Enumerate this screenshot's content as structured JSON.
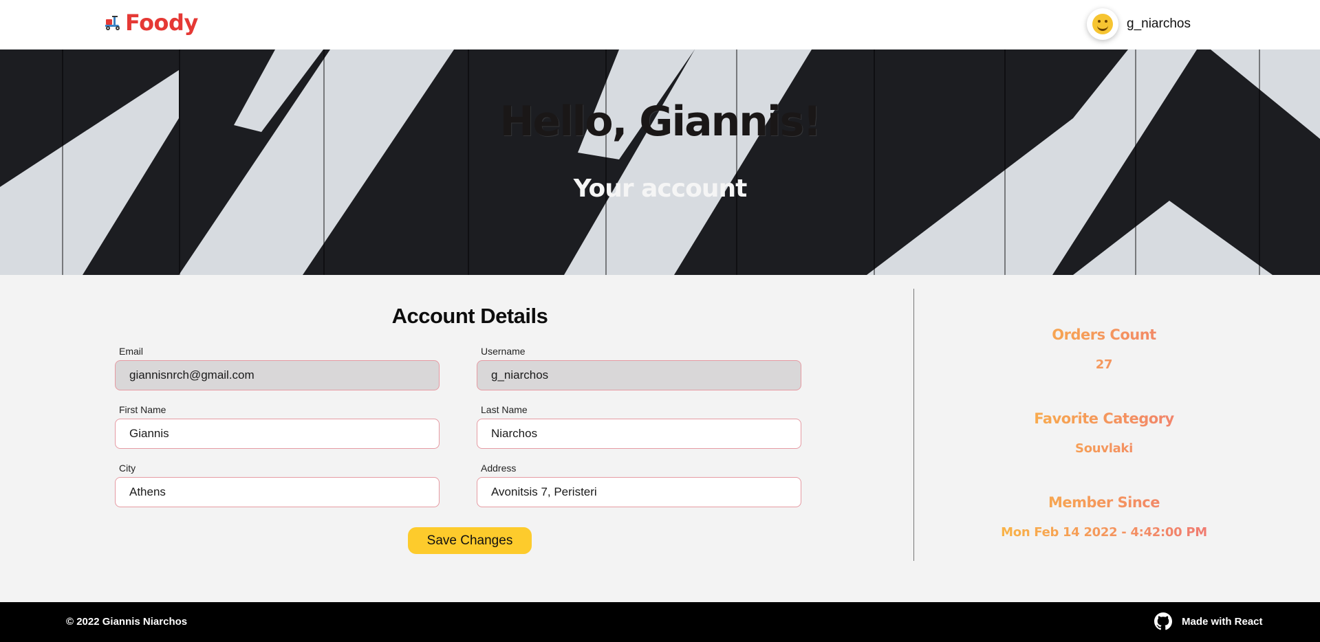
{
  "header": {
    "brand": "Foody",
    "username": "g_niarchos"
  },
  "hero": {
    "greeting": "Hello, Giannis!",
    "subtitle": "Your account"
  },
  "account": {
    "title": "Account Details",
    "fields": {
      "email": {
        "label": "Email",
        "value": "giannisnrch@gmail.com"
      },
      "username": {
        "label": "Username",
        "value": "g_niarchos"
      },
      "first_name": {
        "label": "First Name",
        "value": "Giannis"
      },
      "last_name": {
        "label": "Last Name",
        "value": "Niarchos"
      },
      "city": {
        "label": "City",
        "value": "Athens"
      },
      "address": {
        "label": "Address",
        "value": "Avonitsis 7, Peristeri"
      }
    },
    "save_label": "Save Changes"
  },
  "stats": {
    "orders_label": "Orders Count",
    "orders_value": "27",
    "favorite_label": "Favorite Category",
    "favorite_value": "Souvlaki",
    "member_label": "Member Since",
    "member_value": "Mon Feb 14 2022 - 4:42:00 PM"
  },
  "footer": {
    "copyright": "© 2022 Giannis Niarchos",
    "made_with": "Made with React"
  },
  "colors": {
    "brand": "#e53935",
    "button": "#fdcb2c",
    "field_border": "#e59aa2",
    "stat_gradient_start": "#fbbf3d",
    "stat_gradient_end": "#ee6f7b"
  },
  "icons": {
    "logo": "scooter-icon",
    "avatar": "smiley-avatar-icon",
    "footer": "github-icon"
  }
}
